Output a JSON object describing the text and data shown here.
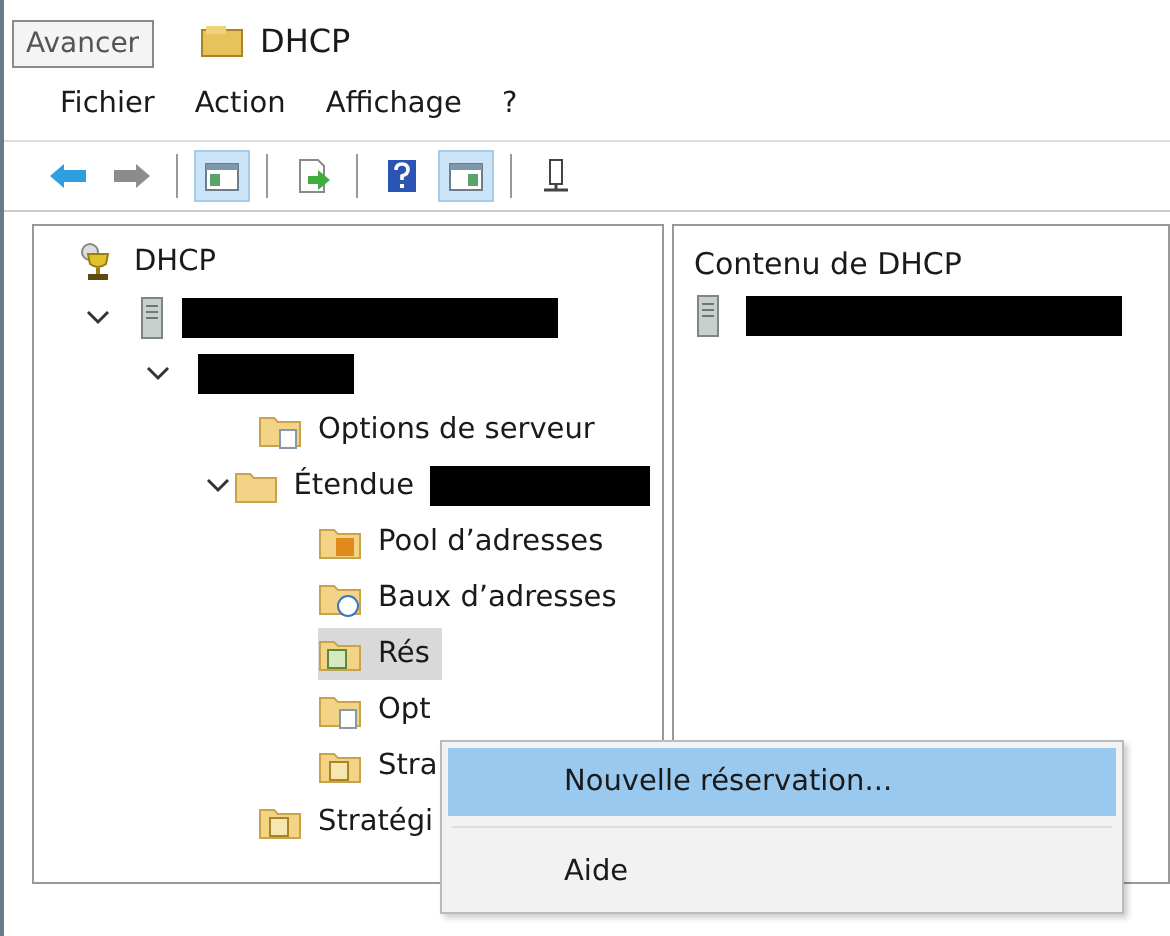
{
  "window": {
    "title": "DHCP"
  },
  "tooltip": "Avancer",
  "menu_bar": [
    "Fichier",
    "Action",
    "Affichage",
    "?"
  ],
  "toolbar": [
    {
      "kind": "back",
      "pressed": false
    },
    {
      "kind": "forward",
      "pressed": false
    },
    {
      "kind": "separator"
    },
    {
      "kind": "tree",
      "pressed": true
    },
    {
      "kind": "separator"
    },
    {
      "kind": "export",
      "pressed": false
    },
    {
      "kind": "separator"
    },
    {
      "kind": "help",
      "pressed": false
    },
    {
      "kind": "actionpane",
      "pressed": true
    },
    {
      "kind": "separator"
    },
    {
      "kind": "server",
      "pressed": false
    }
  ],
  "tree": [
    {
      "label": "DHCP",
      "kind": "dhcp",
      "selected": false,
      "children": [
        {
          "kind": "server",
          "redacted": true,
          "expanded": true,
          "selected": false,
          "children": [
            {
              "kind": "none",
              "redacted": true,
              "expanded": true,
              "selected": false,
              "children": [
                {
                  "label": "Options de serveur",
                  "kind": "options",
                  "selected": false
                },
                {
                  "label": "Étendue",
                  "kind": "scope",
                  "redacted": true,
                  "expanded": true,
                  "selected": false,
                  "children": [
                    {
                      "label": "Pool d’adresses",
                      "kind": "pool",
                      "selected": false
                    },
                    {
                      "label": "Baux d’adresses",
                      "kind": "leases",
                      "selected": false
                    },
                    {
                      "label": "Rés",
                      "kind": "reservations",
                      "selected": true
                    },
                    {
                      "label": "Opt",
                      "kind": "scope-options",
                      "selected": false
                    },
                    {
                      "label": "Stra",
                      "kind": "policies",
                      "selected": false
                    }
                  ]
                },
                {
                  "label": "Stratégi",
                  "kind": "policies",
                  "selected": false
                }
              ]
            }
          ]
        }
      ]
    }
  ],
  "content": {
    "title": "Contenu de DHCP",
    "items": [
      {
        "kind": "server",
        "redacted": true
      }
    ]
  },
  "context_menu": [
    {
      "label": "Nouvelle réservation...",
      "selected": true
    },
    {
      "label": "Aide",
      "selected": false
    }
  ]
}
